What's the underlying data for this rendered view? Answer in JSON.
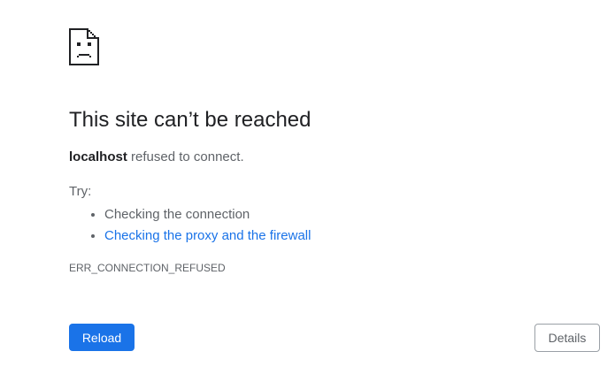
{
  "icon": {
    "name": "sad-page-icon",
    "color": "#202124"
  },
  "title": "This site can’t be reached",
  "message": {
    "host": "localhost",
    "text": " refused to connect."
  },
  "try_label": "Try:",
  "suggestions": [
    {
      "label": "Checking the connection",
      "is_link": false
    },
    {
      "label": "Checking the proxy and the firewall",
      "is_link": true
    }
  ],
  "error_code": "ERR_CONNECTION_REFUSED",
  "buttons": {
    "reload_label": "Reload",
    "details_label": "Details"
  },
  "colors": {
    "primary": "#1a73e8",
    "title": "#202124",
    "body_text": "#5f6368",
    "button_border": "#9aa0a6"
  }
}
